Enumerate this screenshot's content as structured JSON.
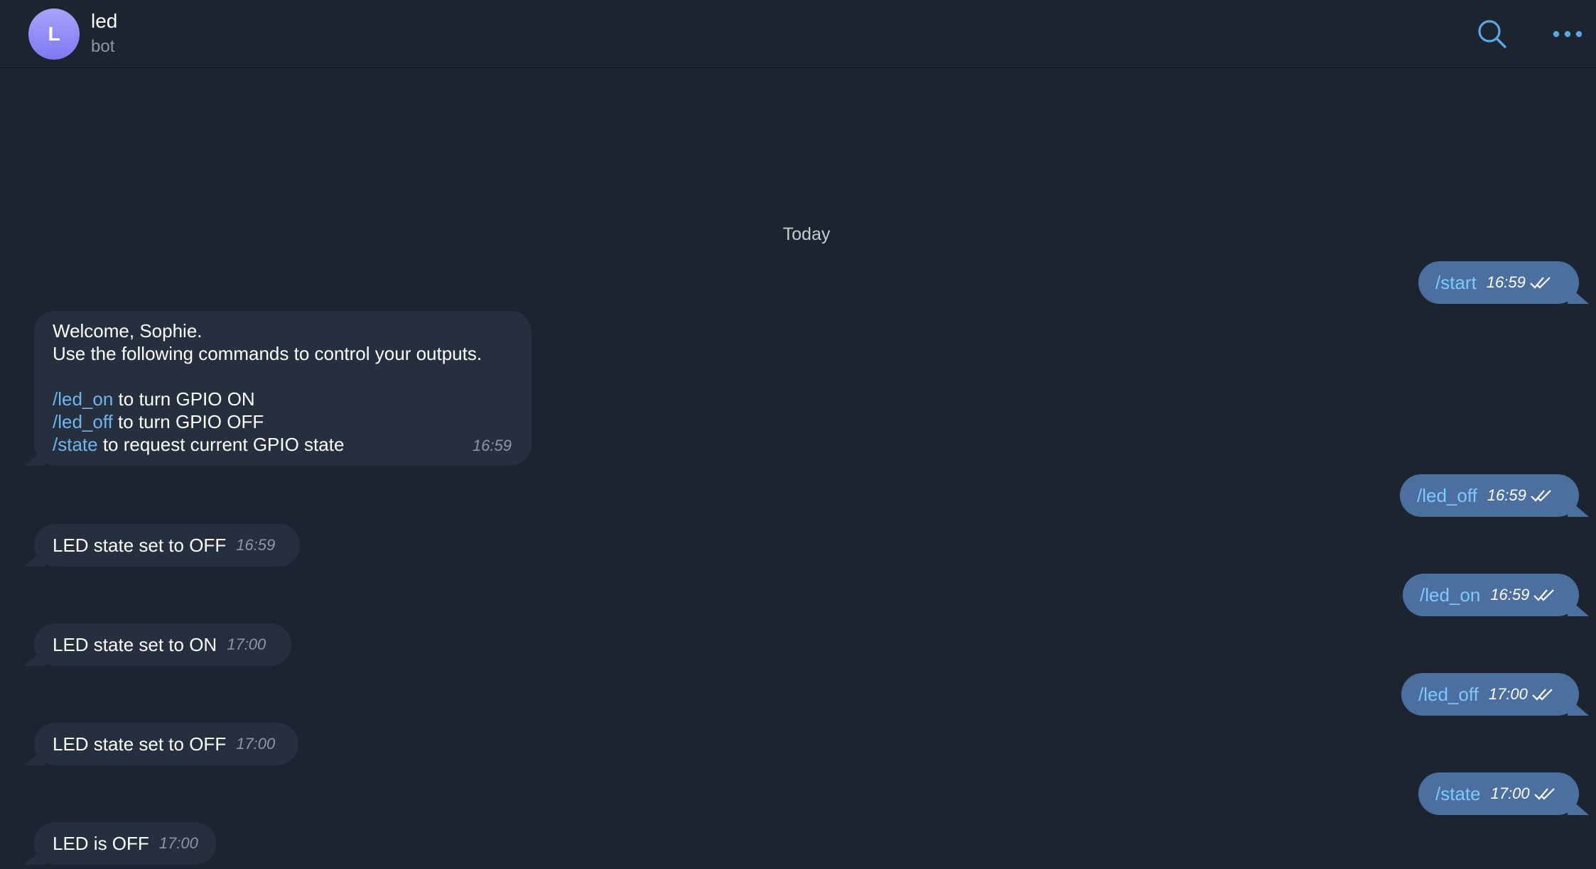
{
  "header": {
    "avatar_letter": "L",
    "title": "led",
    "subtitle": "bot",
    "search_icon": "search-icon",
    "more_icon": "more-dots-icon"
  },
  "date_separator": "Today",
  "colors": {
    "background": "#1c2430",
    "incoming_bubble": "#252f3e",
    "outgoing_bubble": "#4b709f",
    "link": "#6fb5f0",
    "accent": "#5aa7e6"
  },
  "messages": [
    {
      "direction": "out",
      "command": "/start",
      "time": "16:59",
      "status": "double-check-icon"
    },
    {
      "direction": "in",
      "lines": {
        "greeting": "Welcome, Sophie.",
        "intro": "Use the following commands to control your outputs.",
        "cmd1": "/led_on",
        "cmd1_desc": " to turn GPIO ON",
        "cmd2": "/led_off",
        "cmd2_desc": " to turn GPIO OFF",
        "cmd3": "/state",
        "cmd3_desc": " to request current GPIO state"
      },
      "time": "16:59"
    },
    {
      "direction": "out",
      "command": "/led_off",
      "time": "16:59",
      "status": "double-check-icon"
    },
    {
      "direction": "in",
      "text": "LED state set to OFF",
      "time": "16:59"
    },
    {
      "direction": "out",
      "command": "/led_on",
      "time": "16:59",
      "status": "double-check-icon"
    },
    {
      "direction": "in",
      "text": "LED state set to ON",
      "time": "17:00"
    },
    {
      "direction": "out",
      "command": "/led_off",
      "time": "17:00",
      "status": "double-check-icon"
    },
    {
      "direction": "in",
      "text": "LED state set to OFF",
      "time": "17:00"
    },
    {
      "direction": "out",
      "command": "/state",
      "time": "17:00",
      "status": "double-check-icon"
    },
    {
      "direction": "in",
      "text": "LED is OFF",
      "time": "17:00"
    }
  ]
}
